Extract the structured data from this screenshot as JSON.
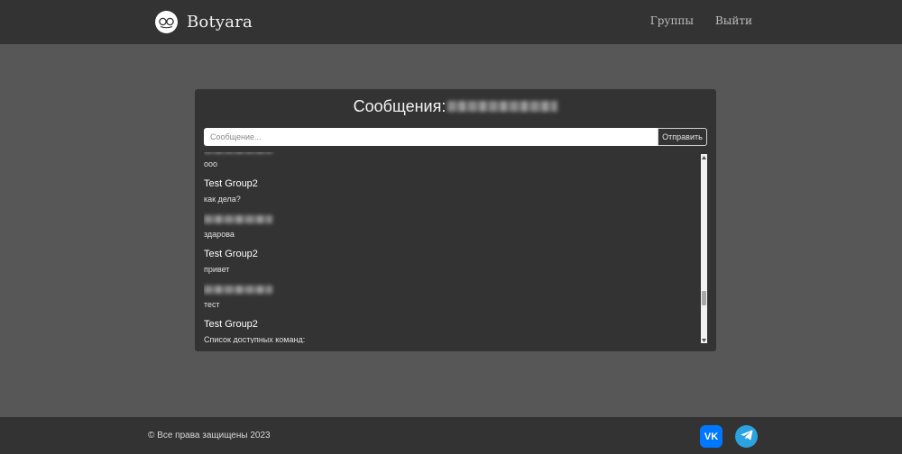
{
  "navbar": {
    "brand_name": "Botyara",
    "logo_icon": "bot-glasses-icon",
    "links": [
      {
        "label": "Группы"
      },
      {
        "label": "Выйти"
      }
    ]
  },
  "chat": {
    "title": "Сообщения:",
    "input_placeholder": "Сообщение...",
    "send_label": "Отправить",
    "messages": [
      {
        "author": "",
        "author_hidden": true,
        "text": "ооо"
      },
      {
        "author": "Test Group2",
        "text": "как дела?"
      },
      {
        "author": "",
        "author_hidden": true,
        "text": "здарова"
      },
      {
        "author": "Test Group2",
        "text": "привет"
      },
      {
        "author": "",
        "author_hidden": true,
        "text": "тест"
      },
      {
        "author": "Test Group2",
        "text": "Список доступных команд:"
      }
    ],
    "scroll_position": 0.75
  },
  "footer": {
    "copyright": "© Все права защищены 2023",
    "social": [
      {
        "name": "vk",
        "icon": "vk-icon",
        "label": "VK",
        "color": "#0077ff"
      },
      {
        "name": "telegram",
        "icon": "telegram-icon",
        "color": "#2aa3df"
      }
    ]
  },
  "colors": {
    "page_bg": "#575757",
    "panel_bg": "#333333",
    "text": "#e6e6e6"
  }
}
